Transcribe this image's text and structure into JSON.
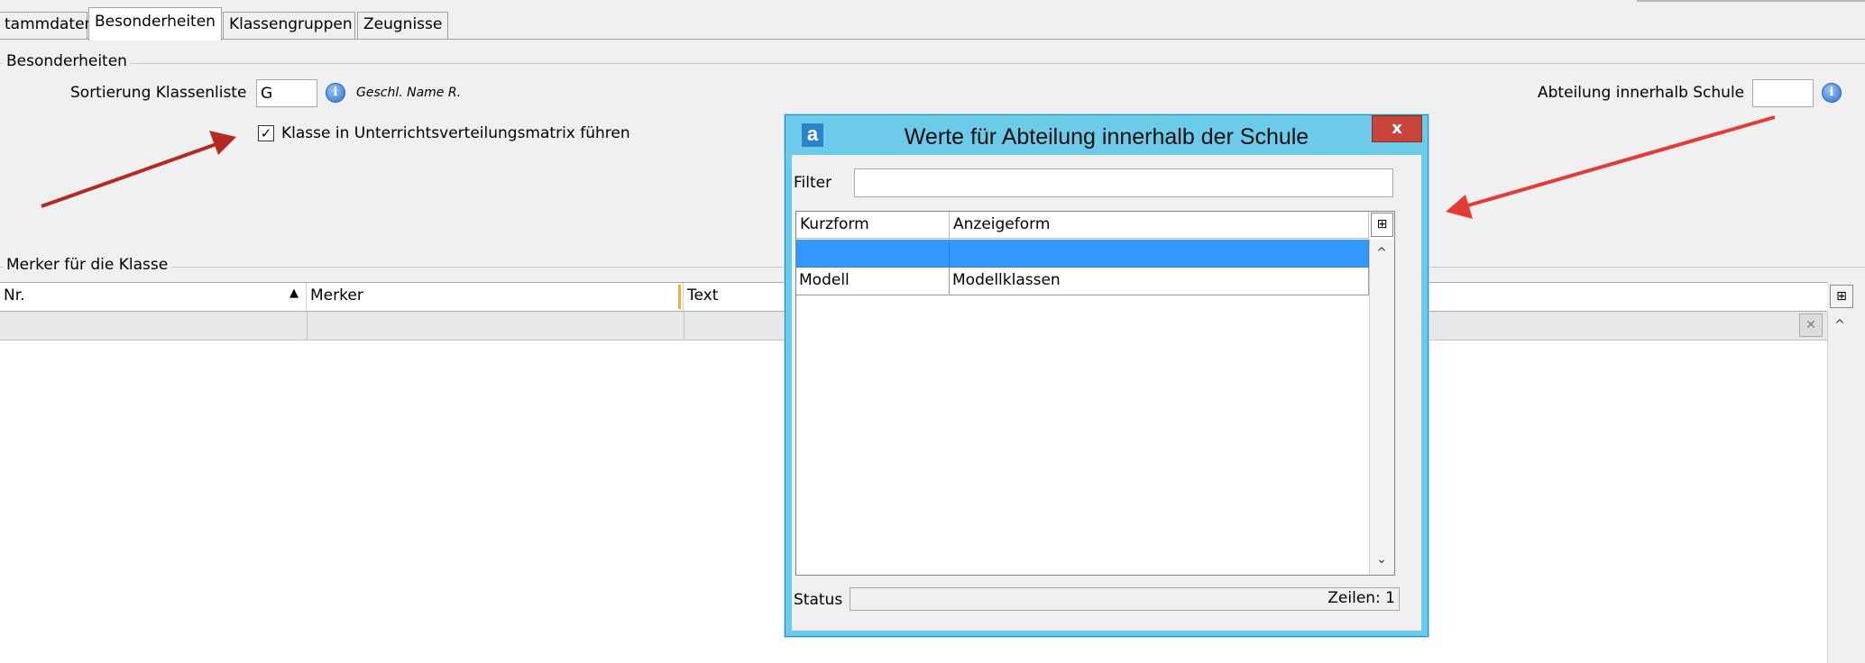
{
  "tabs": [
    {
      "label": "tammdaten"
    },
    {
      "label": "Besonderheiten"
    },
    {
      "label": "Klassengruppen"
    },
    {
      "label": "Zeugnisse"
    }
  ],
  "besonderheiten": {
    "group_title": "Besonderheiten",
    "sortierung_label": "Sortierung Klassenliste",
    "sortierung_value": "G",
    "sortierung_hint": "Geschl. Name R.",
    "checkbox_label": "Klasse in Unterrichtsverteilungsmatrix führen",
    "checkbox_checked": true,
    "abteilung_label": "Abteilung innerhalb Schule",
    "abteilung_value": ""
  },
  "merker": {
    "group_title": "Merker für die Klasse",
    "columns": [
      "Nr.",
      "Merker",
      "Text"
    ]
  },
  "dialog": {
    "title": "Werte für Abteilung innerhalb der Schule",
    "close_label": "x",
    "logo": "a",
    "filter_label": "Filter",
    "filter_value": "",
    "columns": [
      "Kurzform",
      "Anzeigeform"
    ],
    "rows": [
      {
        "kurzform": "",
        "anzeigeform": ""
      },
      {
        "kurzform": "Modell",
        "anzeigeform": "Modellklassen"
      }
    ],
    "status_label": "Status",
    "status_text": "Zeilen: 1"
  },
  "icons": {
    "info": "info-icon",
    "sort_asc": "triangle-up-icon",
    "column_chooser": "column-chooser-icon",
    "clear_filter": "clear-filter-icon",
    "scroll_up": "chevron-up-icon",
    "scroll_down": "chevron-down-icon"
  },
  "colors": {
    "arrow": "#e53b36",
    "selected_row": "#3399ff",
    "dialog_frame": "#6ccbe9",
    "close_button": "#c8453b"
  }
}
